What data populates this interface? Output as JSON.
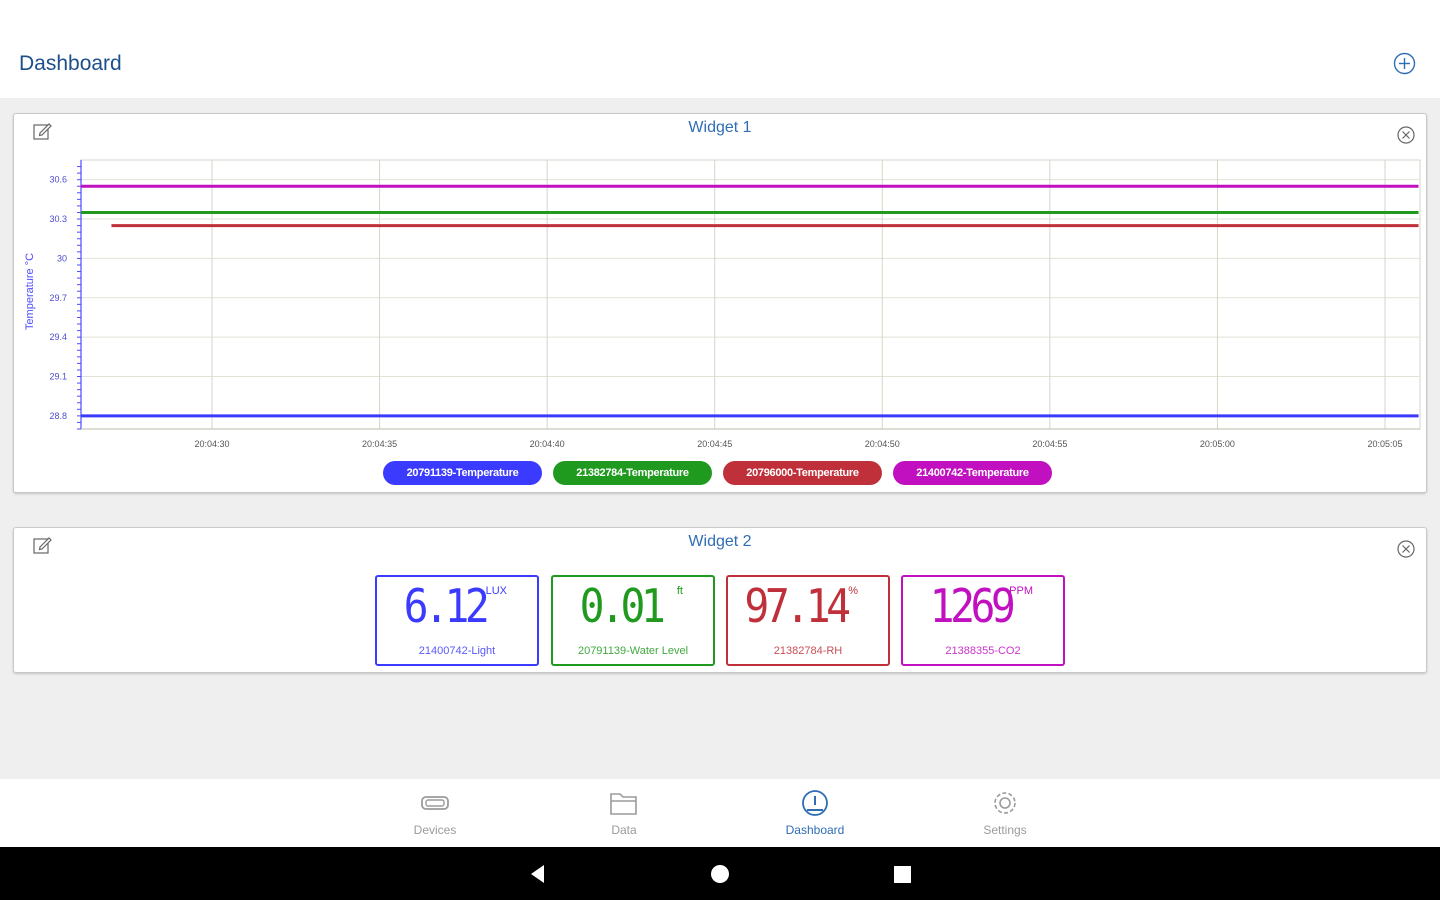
{
  "appbar": {
    "title": "Dashboard",
    "add_icon": "plus-circle-icon"
  },
  "widget1": {
    "title": "Widget 1",
    "chart_data": {
      "type": "line",
      "title": "",
      "xlabel": "",
      "ylabel": "Temperature °C",
      "yticks": [
        "30.6",
        "30.3",
        "30",
        "29.7",
        "29.4",
        "29.1",
        "28.8"
      ],
      "xticks": [
        "20:04:30",
        "20:04:35",
        "20:04:40",
        "20:04:45",
        "20:04:50",
        "20:04:55",
        "20:05:00",
        "20:05:05"
      ],
      "ylim": [
        28.7,
        30.75
      ],
      "grid": true,
      "legend_position": "bottom-center",
      "series": [
        {
          "name": "20791139-Temperature",
          "color": "#3b3bff",
          "x": [
            "20:04:26",
            "20:05:06"
          ],
          "y": [
            28.8,
            28.8
          ]
        },
        {
          "name": "21382784-Temperature",
          "color": "#1f9a1f",
          "x": [
            "20:04:26",
            "20:05:06"
          ],
          "y": [
            30.35,
            30.35
          ]
        },
        {
          "name": "20796000-Temperature",
          "color": "#c0303a",
          "x": [
            "20:04:27",
            "20:05:06"
          ],
          "y": [
            30.25,
            30.25
          ]
        },
        {
          "name": "21400742-Temperature",
          "color": "#c010c0",
          "x": [
            "20:04:26",
            "20:05:06"
          ],
          "y": [
            30.55,
            30.55
          ]
        }
      ]
    }
  },
  "widget2": {
    "title": "Widget 2",
    "tiles": [
      {
        "value": "6.12",
        "unit": "LUX",
        "label": "21400742-Light",
        "color": "#3b3bff"
      },
      {
        "value": "0.01",
        "unit": "ft",
        "label": "20791139-Water Level",
        "color": "#1f9a1f"
      },
      {
        "value": "97.14",
        "unit": "%",
        "label": "21382784-RH",
        "color": "#c0303a"
      },
      {
        "value": "1269",
        "unit": "PPM",
        "label": "21388355-CO2",
        "color": "#c010c0"
      }
    ]
  },
  "bottom_nav": {
    "items": [
      {
        "label": "Devices",
        "icon": "device-icon",
        "active": false
      },
      {
        "label": "Data",
        "icon": "folder-icon",
        "active": false
      },
      {
        "label": "Dashboard",
        "icon": "dashboard-gauge-icon",
        "active": true
      },
      {
        "label": "Settings",
        "icon": "gear-icon",
        "active": false
      }
    ]
  },
  "system_bar": {
    "back_icon": "back-triangle-icon",
    "home_icon": "home-circle-icon",
    "recents_icon": "recents-square-icon"
  },
  "colors": {
    "accent": "#2f6db5",
    "title": "#1d4f8a"
  }
}
